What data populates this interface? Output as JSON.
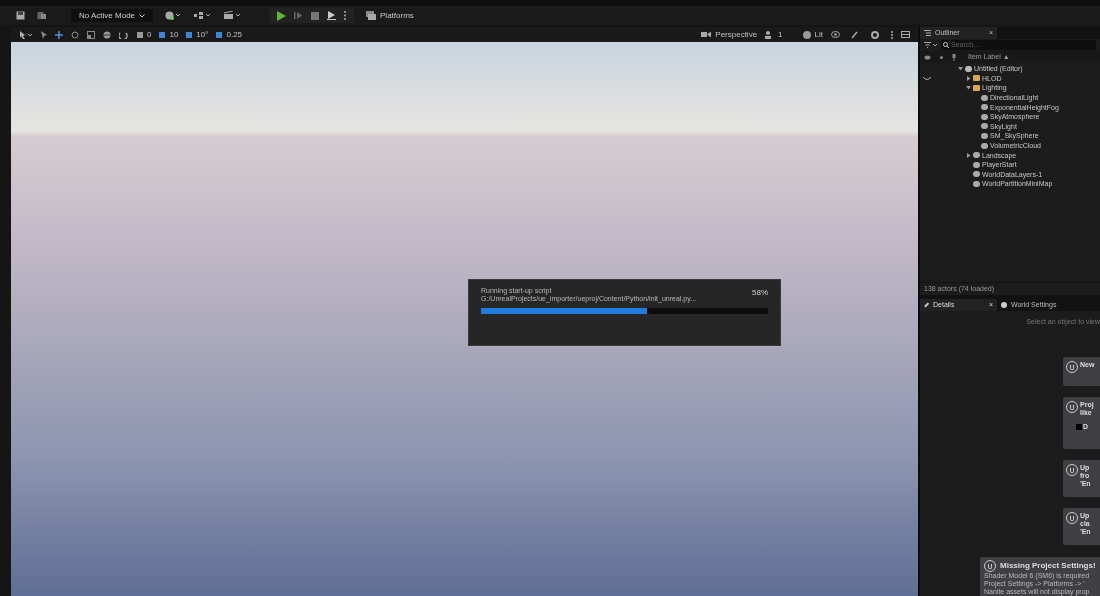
{
  "main_toolbar": {
    "mode": "No Active Mode",
    "platforms": "Platforms"
  },
  "viewport_toolbar": {
    "snaps": [
      "0",
      "10",
      "10°",
      "0.25"
    ],
    "view_mode": "Perspective",
    "camera_count": "1",
    "lighting": "Lit"
  },
  "progress_dialog": {
    "message": "Running start-up script G:/UnrealProjects/ue_importer/ueproj/Content/Python/init_unreal.py...",
    "percent": "58%",
    "level": 0.58
  },
  "outliner": {
    "title": "Outliner",
    "close": "×",
    "search": {
      "placeholder": "Search..."
    },
    "column": "Item Label ▲",
    "tree": [
      {
        "label": "Untitled (Editor)",
        "kind": "world",
        "expanded": true,
        "children": [
          {
            "label": "HLOD",
            "kind": "folder",
            "expanded": false
          },
          {
            "label": "Lighting",
            "kind": "folder",
            "expanded": true,
            "children": [
              {
                "label": "DirectionalLight",
                "kind": "actor"
              },
              {
                "label": "ExponentialHeightFog",
                "kind": "actor"
              },
              {
                "label": "SkyAtmosphere",
                "kind": "actor"
              },
              {
                "label": "SkyLight",
                "kind": "actor"
              },
              {
                "label": "SM_SkySphere",
                "kind": "actor"
              },
              {
                "label": "VolumetricCloud",
                "kind": "actor"
              }
            ]
          },
          {
            "label": "Landscape",
            "kind": "actor",
            "expanded": false
          },
          {
            "label": "PlayerStart",
            "kind": "actor"
          },
          {
            "label": "WorldDataLayers-1",
            "kind": "actor"
          },
          {
            "label": "WorldPartitionMiniMap",
            "kind": "actor"
          }
        ]
      }
    ],
    "footer": "138 actors (74 loaded)"
  },
  "details_tabs": [
    {
      "label": "Details",
      "close": "×",
      "selected": true
    },
    {
      "label": "World Settings",
      "selected": false
    }
  ],
  "details_hint": "Select an object to view",
  "notifications": [
    {
      "lines": [
        "New"
      ],
      "checkbox": false
    },
    {
      "lines": [
        "Proj",
        "like"
      ],
      "checkbox": true,
      "checkbox_label": "D"
    },
    {
      "lines": [
        "Up",
        "fro",
        "'En"
      ],
      "checkbox": false
    },
    {
      "lines": [
        "Up",
        "cla",
        "'En"
      ],
      "checkbox": false
    }
  ],
  "missing_settings": {
    "title": "Missing Project Settings!",
    "lines": [
      "Shader Model 6 (SM6) is required",
      "Project Settings -> Platforms -> '",
      "Nanite assets will not display prop"
    ]
  }
}
